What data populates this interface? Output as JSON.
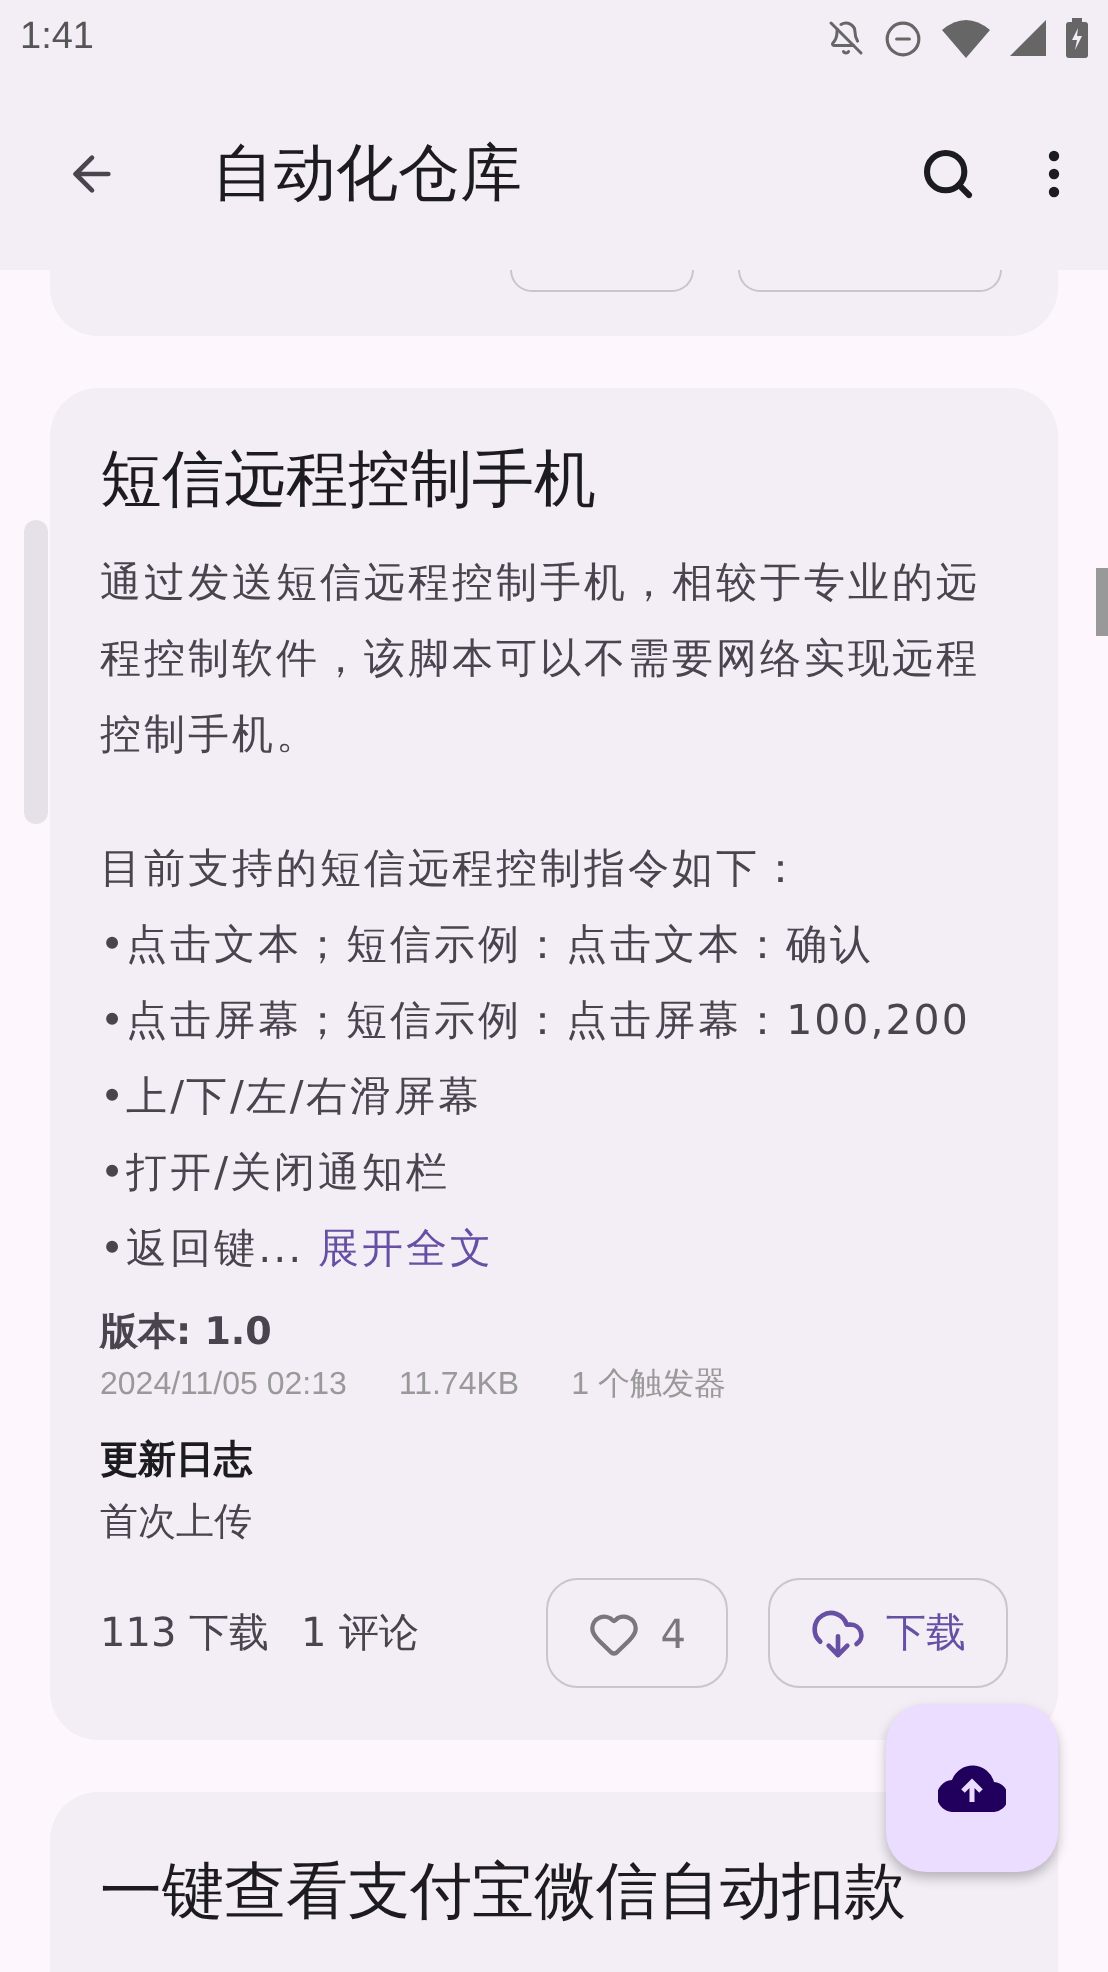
{
  "status_bar": {
    "time": "1:41"
  },
  "app_bar": {
    "title": "自动化仓库"
  },
  "script": {
    "title": "短信远程控制手机",
    "intro": "通过发送短信远程控制手机，相较于专业的远程控制软件，该脚本可以不需要网络实现远程控制手机。",
    "commands_heading": "目前支持的短信远程控制指令如下：",
    "commands": [
      "•点击文本；短信示例：点击文本：确认",
      "•点击屏幕；短信示例：点击屏幕：100,200",
      "•上/下/左/右滑屏幕",
      "•打开/关闭通知栏",
      "•返回键..."
    ],
    "expand_link": "展开全文",
    "version": "版本: 1.0",
    "date": "2024/11/05 02:13",
    "size": "11.74KB",
    "triggers": "1 个触发器",
    "changelog_title": "更新日志",
    "changelog": "首次上传",
    "downloads": "113 下载",
    "comments": "1 评论",
    "likes": "4",
    "download_button": "下载"
  },
  "next_script": {
    "title": "一键查看支付宝微信自动扣款"
  }
}
